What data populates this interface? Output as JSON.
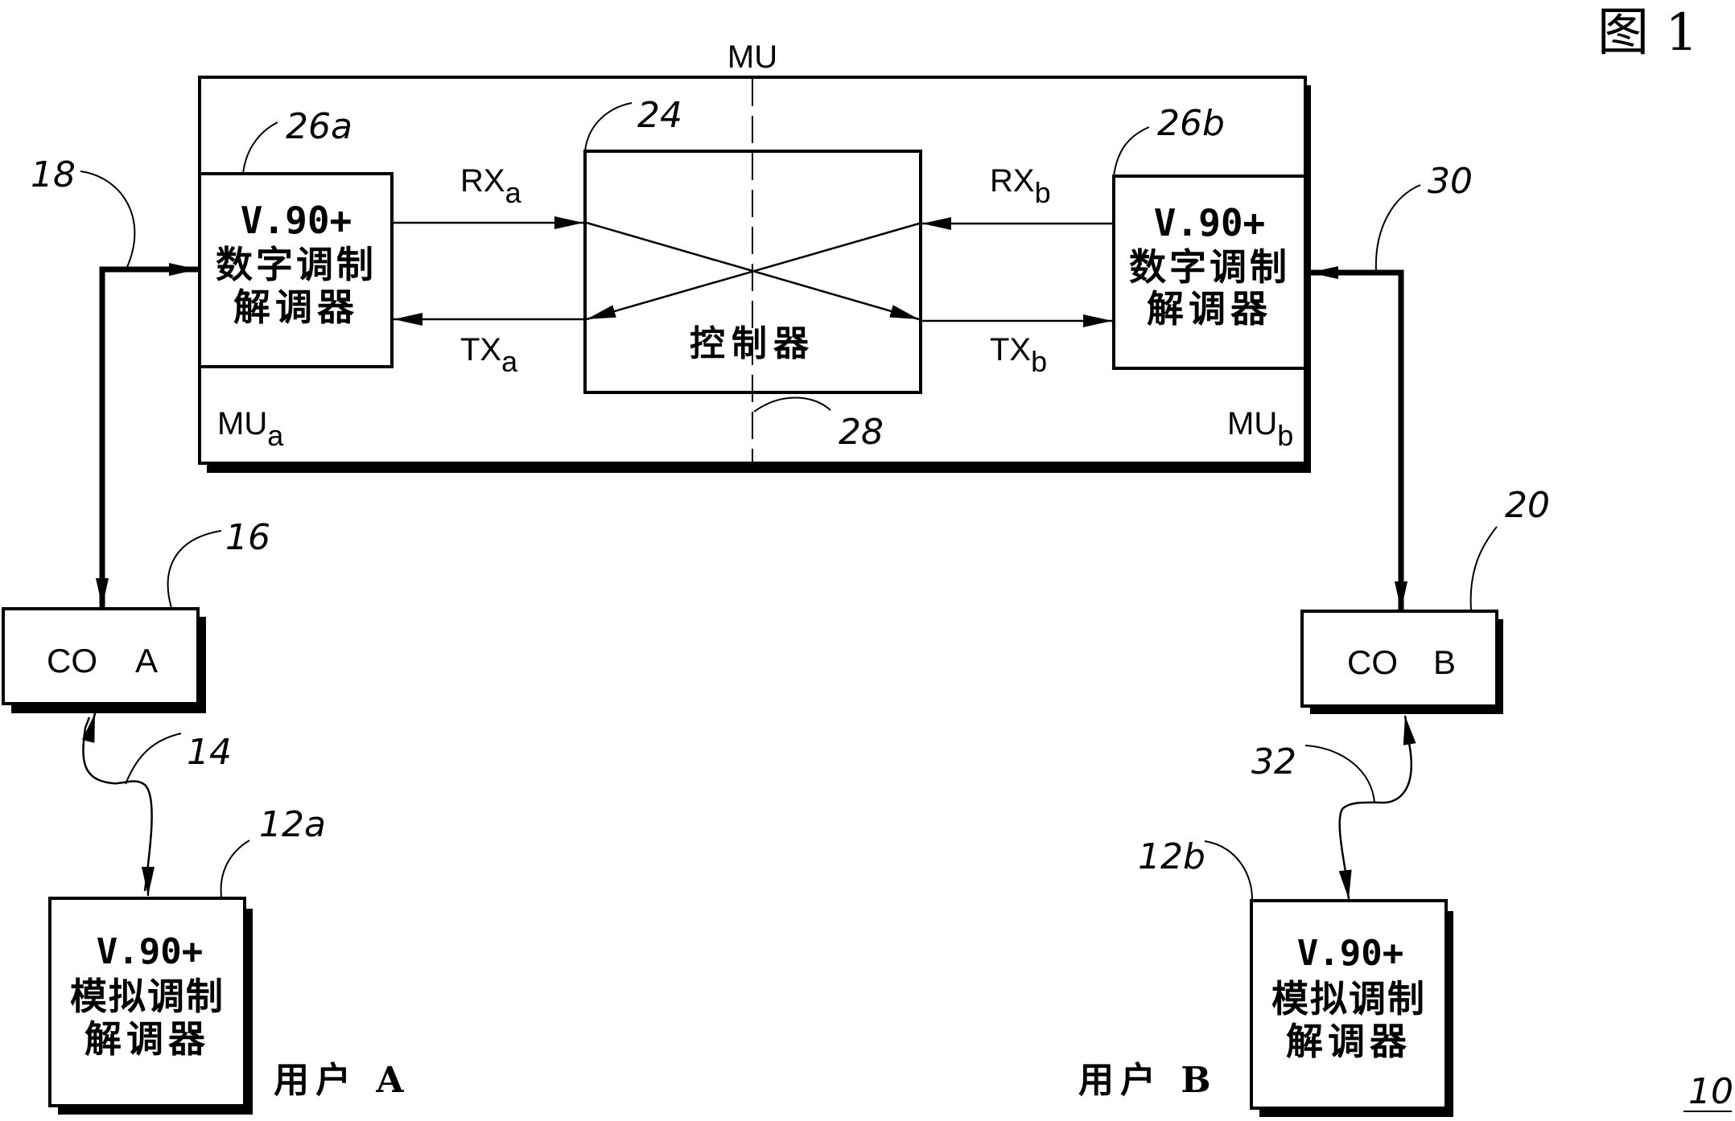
{
  "figure": {
    "label": "图 1",
    "ref": "10"
  },
  "mu": {
    "title": "MU",
    "left_label": "MU",
    "left_sub": "a",
    "right_label": "MU",
    "right_sub": "b",
    "divider_ref": "28"
  },
  "controller": {
    "label": "控制器",
    "ref": "24"
  },
  "digital_modem_a": {
    "line1": "V.90+",
    "line2": "数字调制",
    "line3": "解调器",
    "ref": "26a"
  },
  "digital_modem_b": {
    "line1": "V.90+",
    "line2": "数字调制",
    "line3": "解调器",
    "ref": "26b"
  },
  "signals": {
    "rx_a": {
      "main": "RX",
      "sub": "a"
    },
    "tx_a": {
      "main": "TX",
      "sub": "a"
    },
    "rx_b": {
      "main": "RX",
      "sub": "b"
    },
    "tx_b": {
      "main": "TX",
      "sub": "b"
    }
  },
  "co_a": {
    "label_left": "CO",
    "label_right": "A",
    "ref": "16"
  },
  "co_b": {
    "label_left": "CO",
    "label_right": "B",
    "ref": "20"
  },
  "analog_modem_a": {
    "line1": "V.90+",
    "line2": "模拟调制",
    "line3": "解调器",
    "ref": "12a"
  },
  "analog_modem_b": {
    "line1": "V.90+",
    "line2": "模拟调制",
    "line3": "解调器",
    "ref": "12b"
  },
  "users": {
    "a": "用户 A",
    "b": "用户 B"
  },
  "links": {
    "mu_to_co_a": "18",
    "mu_to_co_b": "30",
    "co_a_to_user": "14",
    "co_b_to_user": "32"
  }
}
